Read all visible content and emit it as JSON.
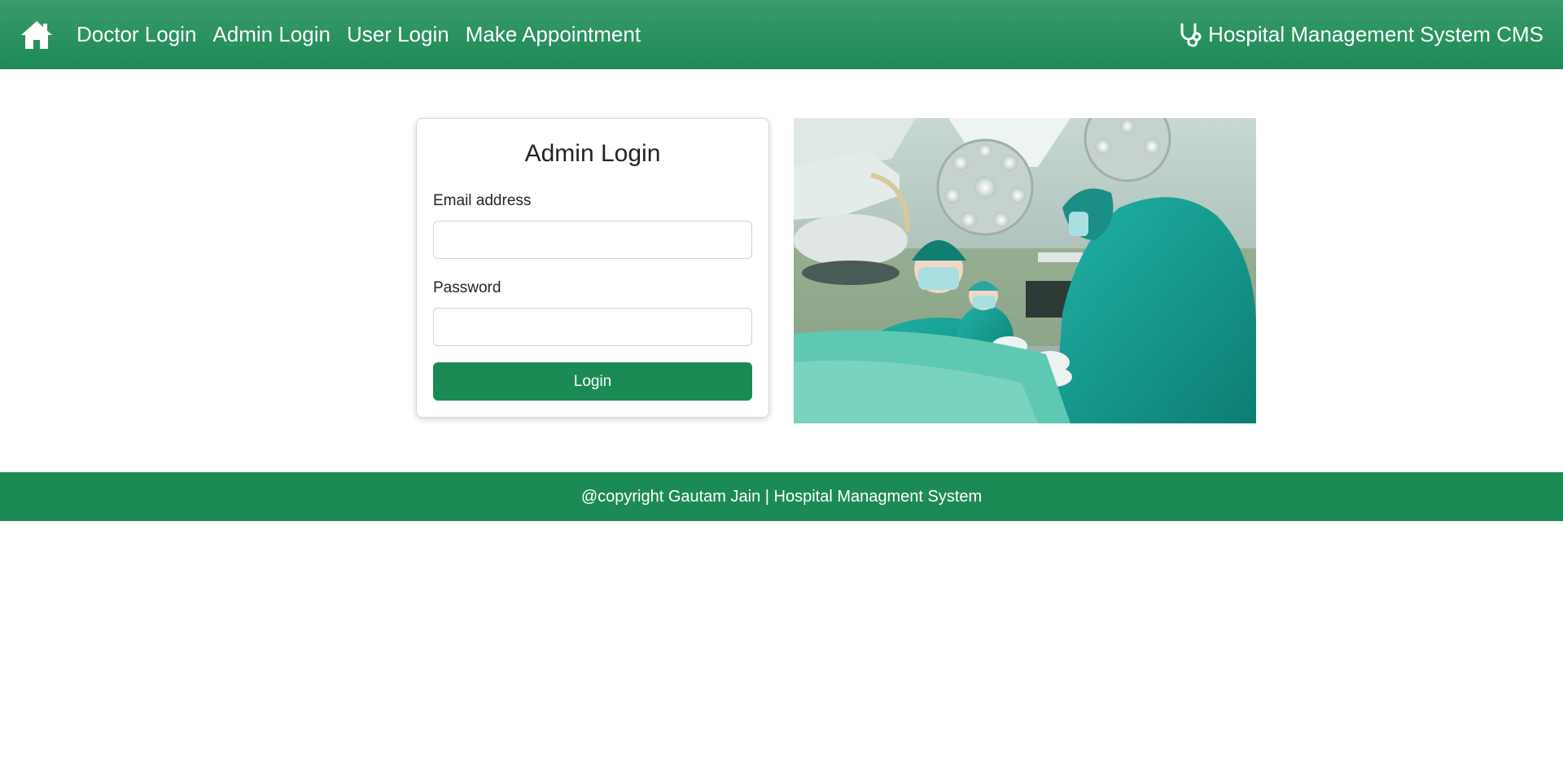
{
  "navbar": {
    "home_icon": "home-icon",
    "links": [
      {
        "label": "Doctor Login"
      },
      {
        "label": "Admin Login"
      },
      {
        "label": "User Login"
      },
      {
        "label": "Make Appointment"
      }
    ],
    "brand_icon": "stethoscope-icon",
    "brand_text": "Hospital Management System CMS",
    "color": "#1c8a55"
  },
  "login_card": {
    "title": "Admin Login",
    "email_label": "Email address",
    "email_value": "",
    "password_label": "Password",
    "password_value": "",
    "submit_label": "Login",
    "button_color": "#1c8a55"
  },
  "hero_image": {
    "description_icon": "surgery-photo"
  },
  "footer": {
    "text": "@copyright Gautam Jain | Hospital Managment System"
  }
}
